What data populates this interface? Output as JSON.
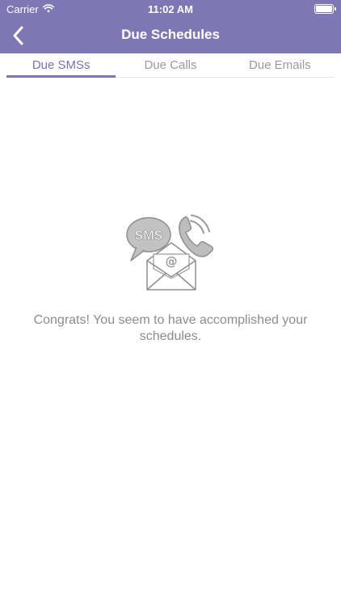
{
  "status_bar": {
    "carrier": "Carrier",
    "time": "11:02 AM",
    "icons": [
      "wifi-icon",
      "battery-icon"
    ]
  },
  "nav": {
    "title": "Due Schedules",
    "back_icon": "chevron-left-icon"
  },
  "tabs": [
    {
      "label": "Due SMSs",
      "active": true
    },
    {
      "label": "Due Calls",
      "active": false
    },
    {
      "label": "Due Emails",
      "active": false
    }
  ],
  "empty_state": {
    "illustration_text": "SMS",
    "illustration_icons": [
      "sms-bubble-icon",
      "phone-icon",
      "email-envelope-icon"
    ],
    "message": "Congrats! You seem to have accomplished your schedules."
  },
  "colors": {
    "header": "#7f77b5",
    "active_tab": "#7a70b0",
    "inactive_tab": "#9a9a9a",
    "message_text": "#8c8c8c"
  }
}
